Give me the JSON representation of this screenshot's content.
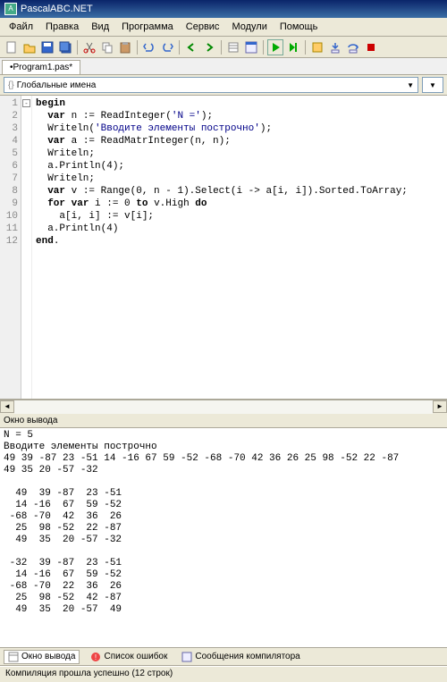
{
  "title": "PascalABC.NET",
  "menu": [
    "Файл",
    "Правка",
    "Вид",
    "Программа",
    "Сервис",
    "Модули",
    "Помощь"
  ],
  "tab": "•Program1.pas*",
  "namespace_label": "Глобальные имена",
  "code_lines": [
    {
      "n": "1",
      "html": "<span class='kw'>begin</span>"
    },
    {
      "n": "2",
      "html": "  <span class='kw'>var</span> n := ReadInteger(<span class='str'>'N ='</span>);"
    },
    {
      "n": "3",
      "html": "  Writeln(<span class='str'>'Вводите элементы построчно'</span>);"
    },
    {
      "n": "4",
      "html": "  <span class='kw'>var</span> a := ReadMatrInteger(n, n);"
    },
    {
      "n": "5",
      "html": "  Writeln;"
    },
    {
      "n": "6",
      "html": "  a.Println(<span class='num'>4</span>);"
    },
    {
      "n": "7",
      "html": "  Writeln;"
    },
    {
      "n": "8",
      "html": "  <span class='kw'>var</span> v := Range(<span class='num'>0</span>, n - <span class='num'>1</span>).Select(i -> a[i, i]).Sorted.ToArray;"
    },
    {
      "n": "9",
      "html": "  <span class='kw'>for</span> <span class='kw'>var</span> i := <span class='num'>0</span> <span class='kw'>to</span> v.High <span class='kw'>do</span>"
    },
    {
      "n": "10",
      "html": "    a[i, i] := v[i];"
    },
    {
      "n": "11",
      "html": "  a.Println(<span class='num'>4</span>)"
    },
    {
      "n": "12",
      "html": "<span class='kw'>end</span>."
    }
  ],
  "output_title": "Окно вывода",
  "output_text": "N = 5\nВводите элементы построчно\n49 39 -87 23 -51 14 -16 67 59 -52 -68 -70 42 36 26 25 98 -52 22 -87\n49 35 20 -57 -32\n\n  49  39 -87  23 -51\n  14 -16  67  59 -52\n -68 -70  42  36  26\n  25  98 -52  22 -87\n  49  35  20 -57 -32\n\n -32  39 -87  23 -51\n  14 -16  67  59 -52\n -68 -70  22  36  26\n  25  98 -52  42 -87\n  49  35  20 -57  49",
  "bottom_tabs": {
    "output": "Окно вывода",
    "errors": "Список ошибок",
    "compiler": "Сообщения компилятора"
  },
  "status": "Компиляция прошла успешно (12 строк)"
}
